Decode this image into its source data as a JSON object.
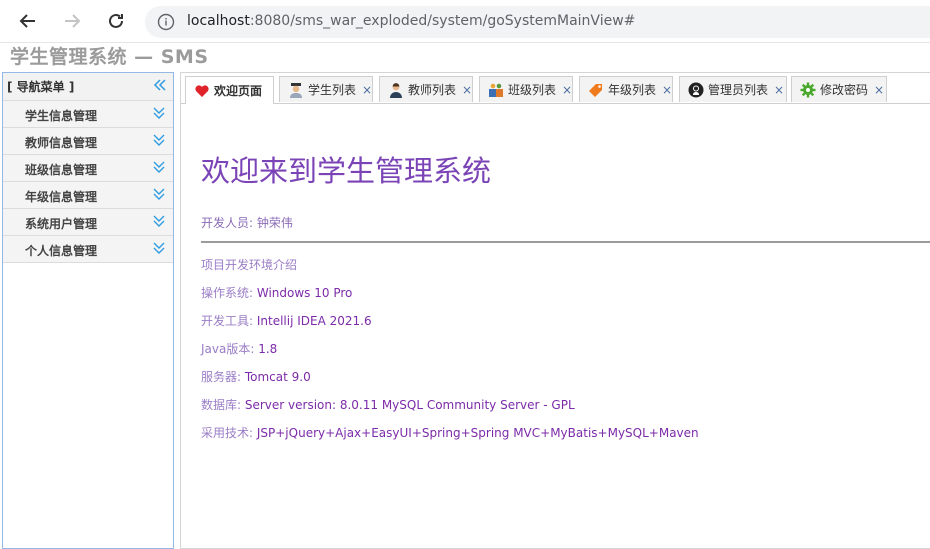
{
  "browser": {
    "url_host": "localhost",
    "url_rest": ":8080/sms_war_exploded/system/goSystemMainView#"
  },
  "app": {
    "title": "学生管理系统 — SMS"
  },
  "nav": {
    "header": "[ 导航菜单 ]",
    "items": [
      {
        "label": "学生信息管理"
      },
      {
        "label": "教师信息管理"
      },
      {
        "label": "班级信息管理"
      },
      {
        "label": "年级信息管理"
      },
      {
        "label": "系统用户管理"
      },
      {
        "label": "个人信息管理"
      }
    ]
  },
  "tabs": [
    {
      "label": "欢迎页面",
      "icon": "heart-icon",
      "active": true
    },
    {
      "label": "学生列表",
      "icon": "student-icon"
    },
    {
      "label": "教师列表",
      "icon": "teacher-icon"
    },
    {
      "label": "班级列表",
      "icon": "class-icon"
    },
    {
      "label": "年级列表",
      "icon": "tag-icon"
    },
    {
      "label": "管理员列表",
      "icon": "github-icon"
    },
    {
      "label": "修改密码",
      "icon": "gear-icon"
    }
  ],
  "welcome": {
    "heading": "欢迎来到学生管理系统",
    "developer_label": "开发人员: ",
    "developer_name": "钟荣伟",
    "env_title": "项目开发环境介绍",
    "env": [
      {
        "k": "操作系统: ",
        "v": "Windows 10 Pro"
      },
      {
        "k": "开发工具: ",
        "v": "Intellij IDEA 2021.6"
      },
      {
        "k": "Java版本: ",
        "v": "1.8"
      },
      {
        "k": "服务器: ",
        "v": "Tomcat 9.0"
      },
      {
        "k": "数据库: ",
        "v": "Server version: 8.0.11 MySQL Community Server - GPL"
      },
      {
        "k": "采用技术: ",
        "v": "JSP+jQuery+Ajax+EasyUI+Spring+Spring MVC+MyBatis+MySQL+Maven"
      }
    ]
  },
  "colors": {
    "accent_purple": "#7a43b6",
    "chevron_blue": "#2f9be0"
  }
}
